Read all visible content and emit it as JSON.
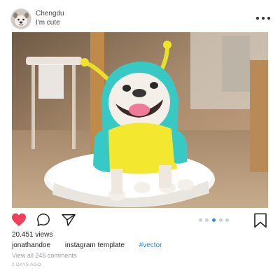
{
  "header": {
    "username": "Chengdu",
    "subtitle": "I'm cute",
    "more_icon": "ellipsis-horizontal-icon"
  },
  "post": {
    "image_alt_subject": "french bulldog in yellow and teal costume with antenna hood on white stool",
    "carousel": {
      "total": 5,
      "active_index": 2
    },
    "views": "20.451 views",
    "caption": {
      "username": "jonathandoe",
      "text": "instagram template",
      "hashtag": "#vector"
    },
    "comments_link": "View all 245 comments",
    "timestamp": "2 DAYS AGO"
  },
  "actions": {
    "like_icon": "heart-filled-icon",
    "comment_icon": "speech-bubble-icon",
    "share_icon": "paper-plane-icon",
    "save_icon": "bookmark-icon"
  },
  "colors": {
    "like": "#f0405a",
    "hashtag": "#2f82c9",
    "active_dot": "#2f8fd8",
    "inactive_dot": "#c6d3dc"
  }
}
